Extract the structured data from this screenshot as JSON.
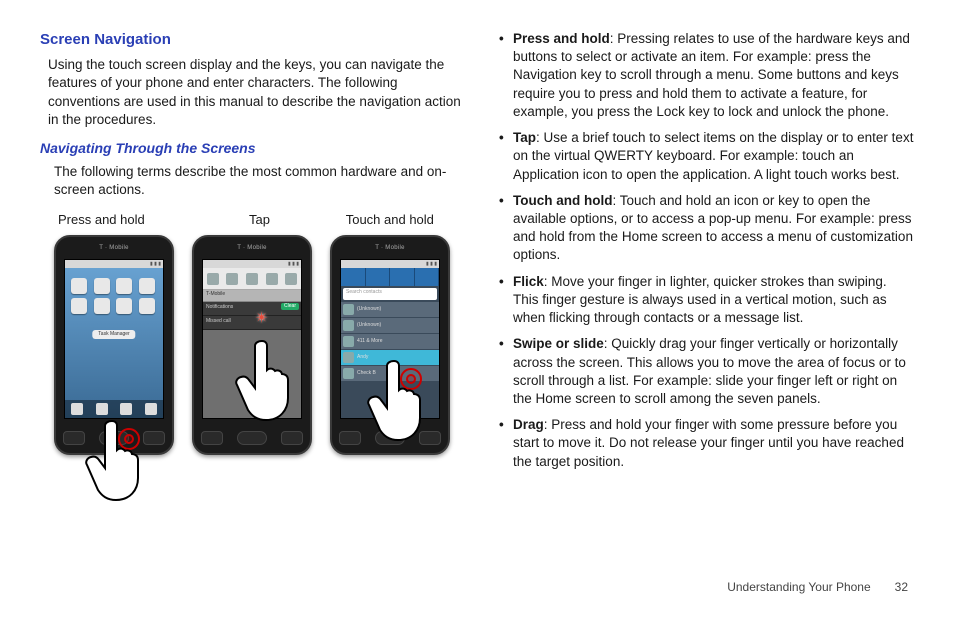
{
  "left": {
    "heading": "Screen Navigation",
    "intro": "Using the touch screen display and the keys, you can navigate the features of your phone and enter characters. The following conventions are used in this manual to describe the navigation action in the procedures.",
    "subheading": "Navigating Through the Screens",
    "subintro": "The following terms describe the most common hardware and on-screen actions.",
    "labels": {
      "a": "Press and hold",
      "b": "Tap",
      "c": "Touch and hold"
    },
    "phone": {
      "carrier": "T · Mobile",
      "badge": "Task Manager",
      "notif_header": "T-Mobile",
      "notif_sub": "Notifications",
      "notif_item": "Missed call",
      "clear": "Clear",
      "search_placeholder": "Search contacts",
      "contacts": [
        "(Unknown)",
        "(Unknown)",
        "411 & More",
        "Andy",
        "Check B"
      ]
    }
  },
  "defs": [
    {
      "term": "Press and hold",
      "text": ": Pressing relates to use of the hardware keys and buttons to select or activate an item. For example: press the Navigation key to scroll through a menu. Some buttons and keys require you to press and hold them to activate a feature, for example, you press the Lock key to lock and unlock the phone."
    },
    {
      "term": "Tap",
      "text": ": Use a brief touch to select items on the display or to enter text on the virtual QWERTY keyboard. For example: touch an Application icon to open the application. A light touch works best."
    },
    {
      "term": "Touch and hold",
      "text": ": Touch and hold an icon or key to open the available options, or to access a pop-up menu. For example: press and hold from the Home screen to access a menu of customization options."
    },
    {
      "term": "Flick",
      "text": ": Move your finger in lighter, quicker strokes than swiping. This finger gesture is always used in a vertical motion, such as when flicking through contacts or a message list."
    },
    {
      "term": "Swipe or slide",
      "text": ": Quickly drag your finger vertically or horizontally across the screen. This allows you to move the area of focus or to scroll through a list. For example: slide your finger left or right on the Home screen to scroll among the seven panels."
    },
    {
      "term": "Drag",
      "text": ": Press and hold your finger with some pressure before you start to move it. Do not release your finger until you have reached the target position."
    }
  ],
  "footer": {
    "section": "Understanding Your Phone",
    "page": "32"
  }
}
